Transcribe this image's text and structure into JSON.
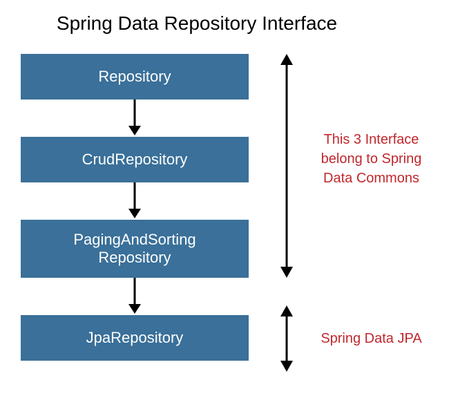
{
  "title": "Spring Data Repository Interface",
  "boxes": {
    "repository": "Repository",
    "crud": "CrudRepository",
    "paging_line1": "PagingAndSorting",
    "paging_line2": "Repository",
    "jpa": "JpaRepository"
  },
  "annotations": {
    "commons_line1": "This 3 Interface",
    "commons_line2": "belong to Spring",
    "commons_line3": "Data Commons",
    "jpa": "Spring Data JPA"
  }
}
